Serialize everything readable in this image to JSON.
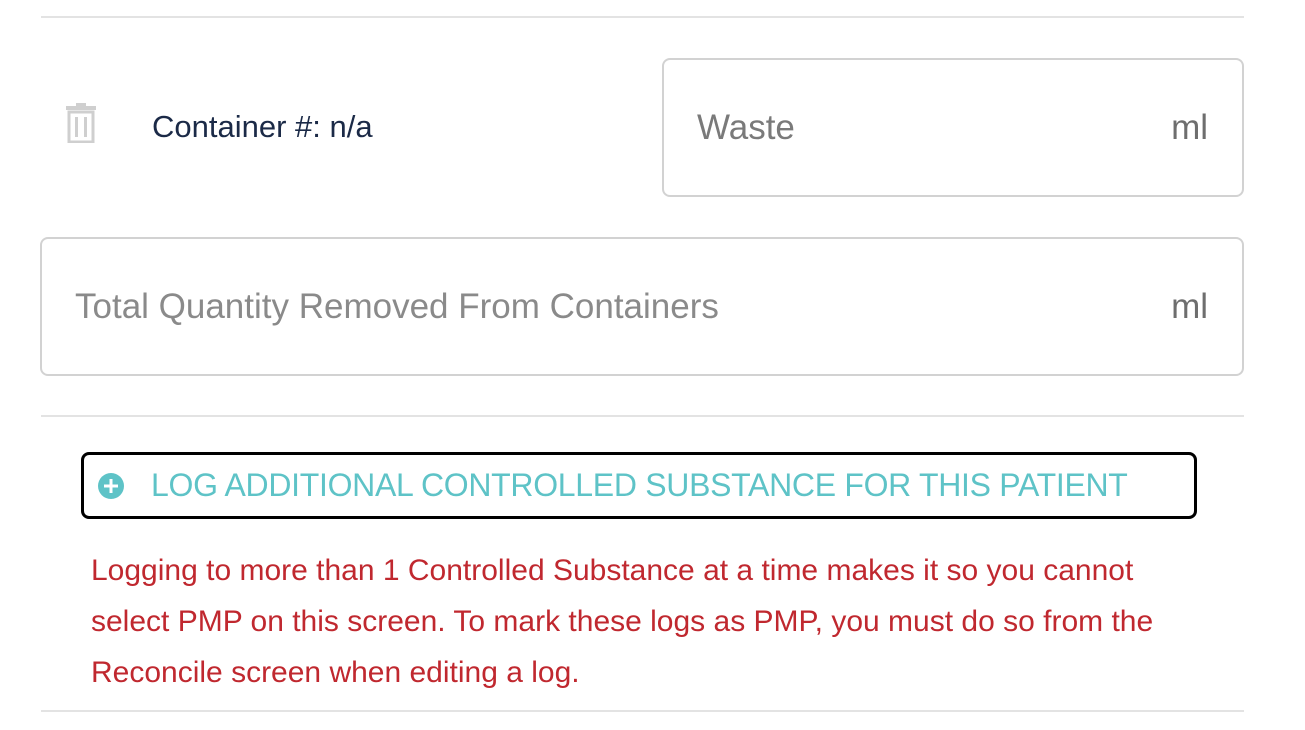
{
  "container": {
    "label": "Container #: n/a",
    "delete_icon": "trash-icon"
  },
  "waste_field": {
    "placeholder": "Waste",
    "unit": "ml"
  },
  "total_field": {
    "placeholder": "Total Quantity Removed From Containers",
    "unit": "ml"
  },
  "log_additional": {
    "icon": "plus-circle-icon",
    "label": "LOG ADDITIONAL CONTROLLED SUBSTANCE FOR THIS PATIENT"
  },
  "warning": {
    "text": "Logging to more than 1 Controlled Substance at a time makes it so you cannot select PMP on this screen. To mark these logs as PMP, you must do so from the Reconcile screen when editing a log."
  },
  "colors": {
    "accent_teal": "#5ec3c7",
    "warning_red": "#c0282f",
    "label_navy": "#1b2a47"
  }
}
